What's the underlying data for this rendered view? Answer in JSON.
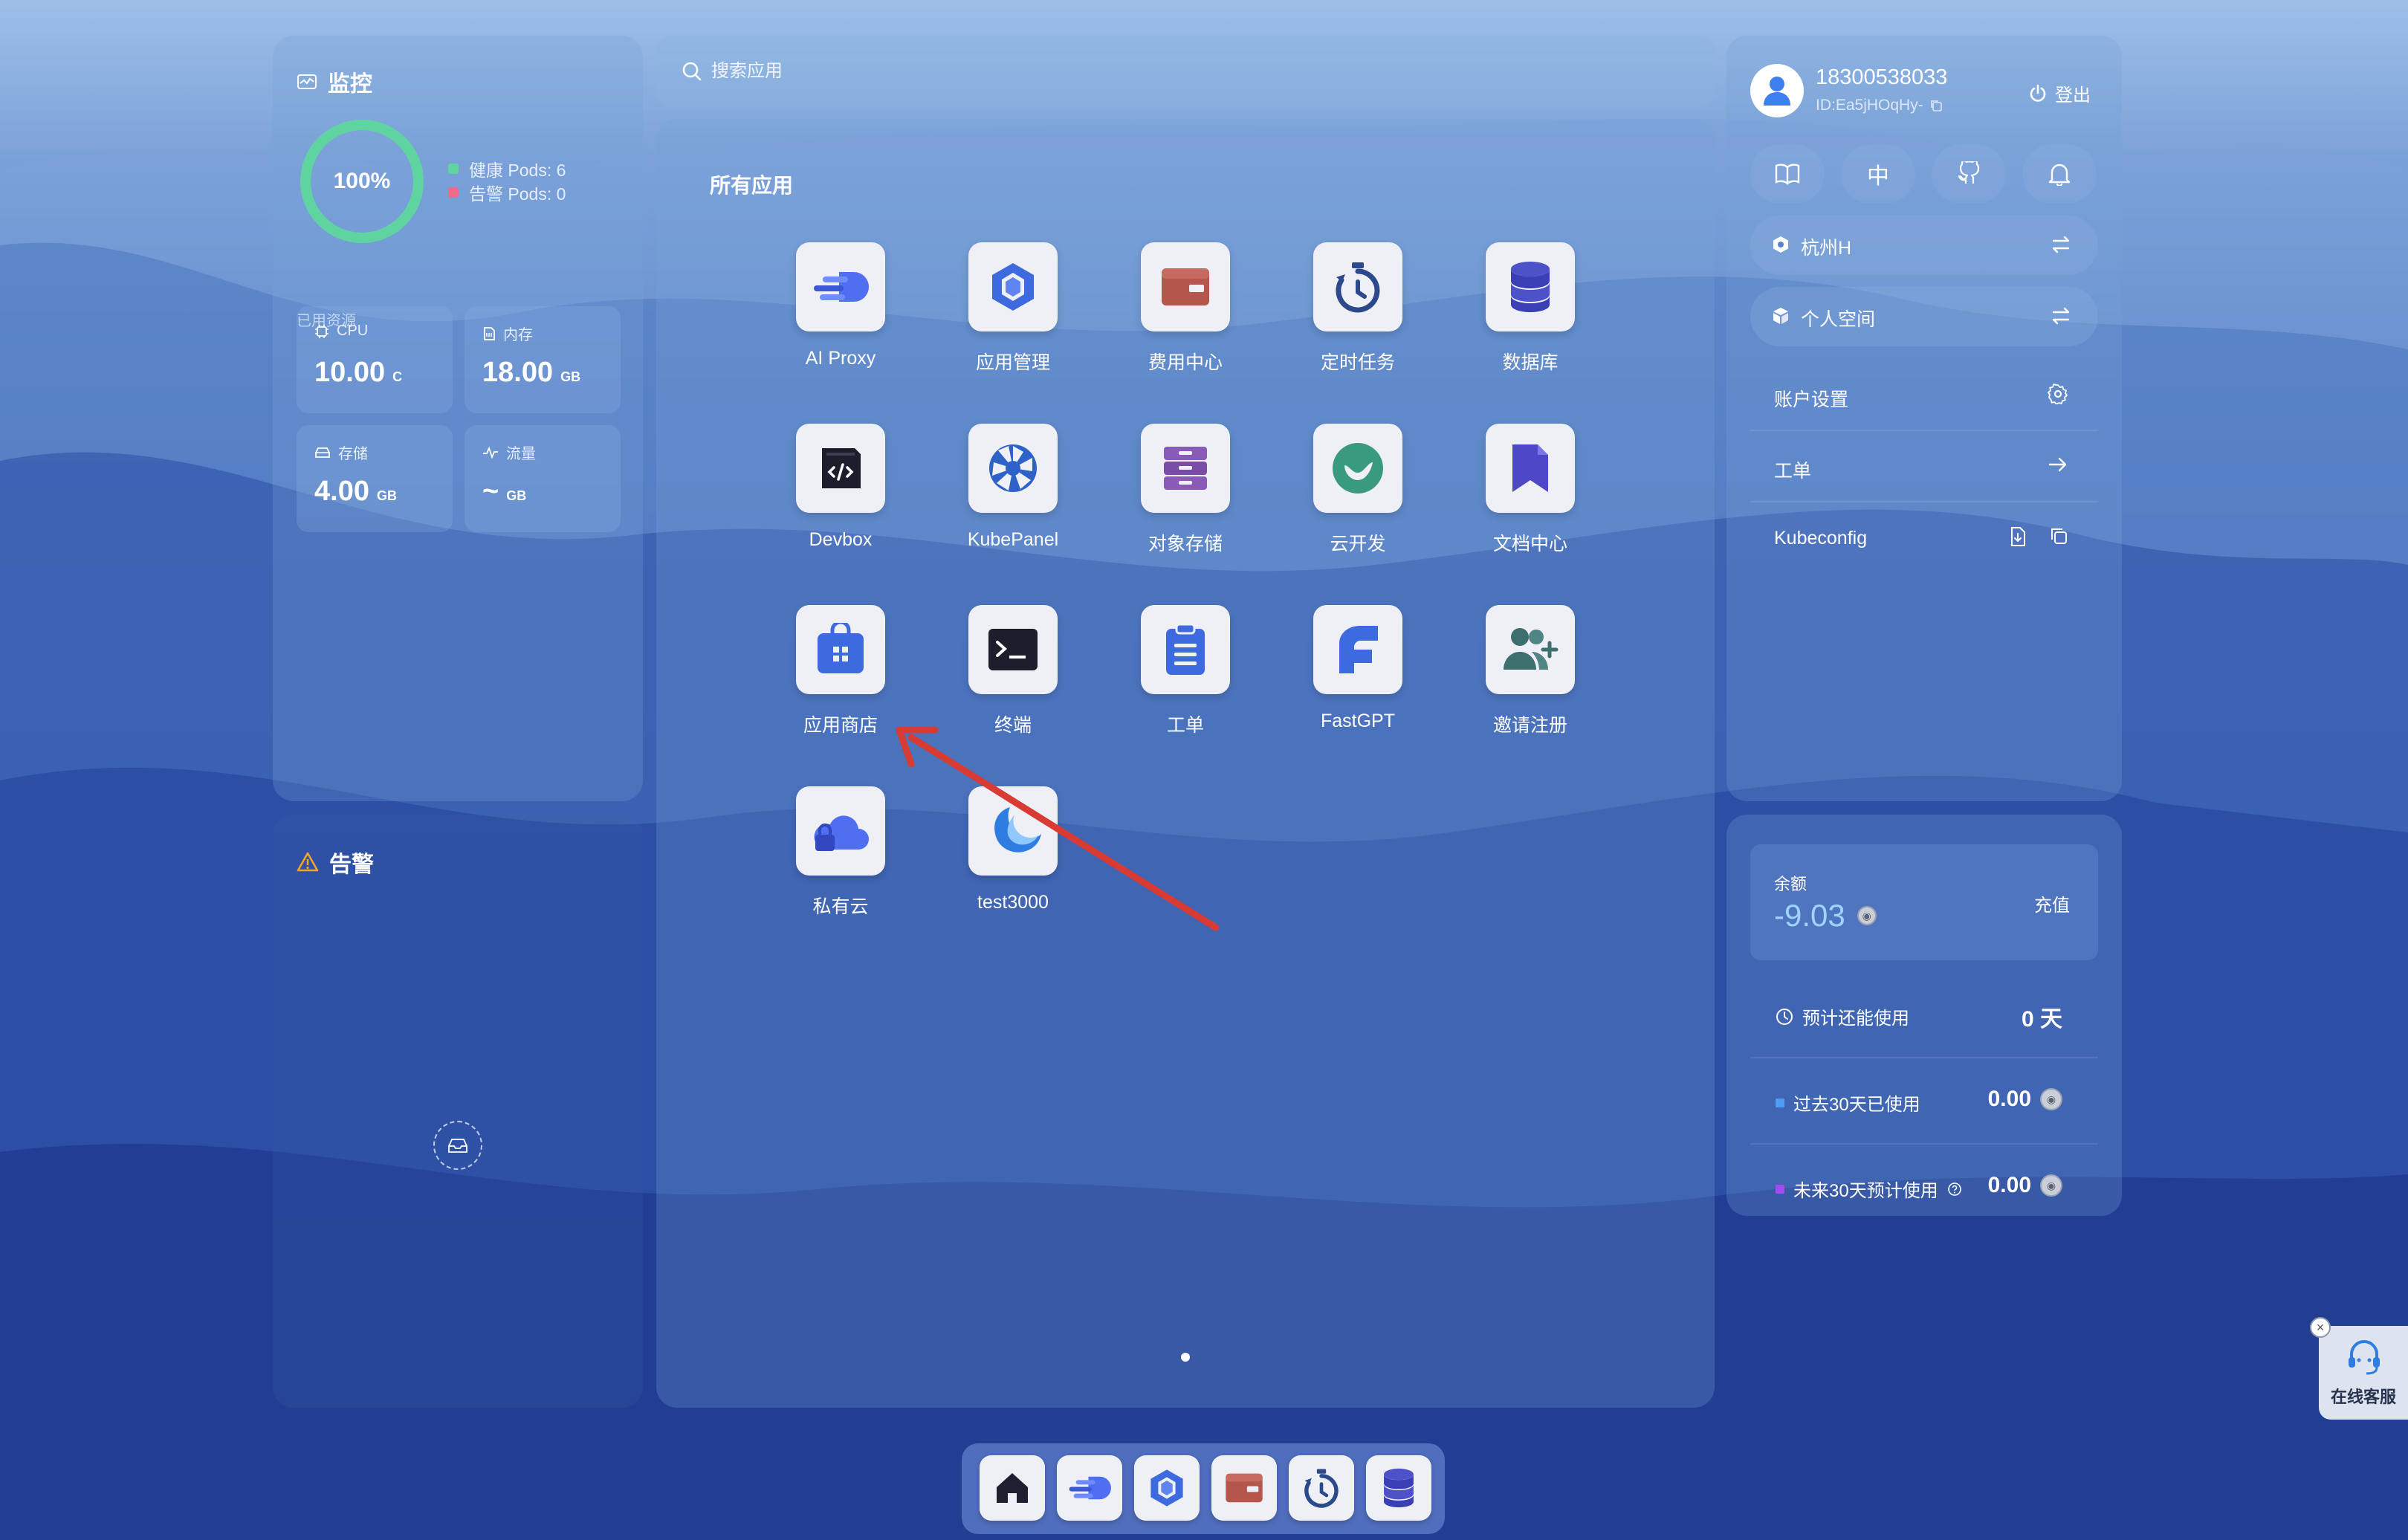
{
  "monitor": {
    "title": "监控",
    "health_percent": "100%",
    "health_fraction": 1.0,
    "healthy_pods": "健康 Pods: 6",
    "alert_pods": "告警 Pods: 0",
    "used_resources_title": "已用资源",
    "resources": [
      {
        "label": "CPU",
        "value": "10.00",
        "unit": "C",
        "icon": "cpu-icon"
      },
      {
        "label": "内存",
        "value": "18.00",
        "unit": "GB",
        "icon": "memory-icon"
      },
      {
        "label": "存储",
        "value": "4.00",
        "unit": "GB",
        "icon": "storage-icon"
      },
      {
        "label": "流量",
        "value": "~",
        "unit": "GB",
        "icon": "traffic-icon"
      }
    ]
  },
  "alerts": {
    "title": "告警"
  },
  "search": {
    "placeholder": "搜索应用"
  },
  "apps": {
    "title": "所有应用",
    "items": [
      {
        "label": "AI Proxy",
        "icon": "ai-proxy-icon"
      },
      {
        "label": "应用管理",
        "icon": "app-manage-icon"
      },
      {
        "label": "费用中心",
        "icon": "wallet-icon"
      },
      {
        "label": "定时任务",
        "icon": "timer-icon"
      },
      {
        "label": "数据库",
        "icon": "database-icon"
      },
      {
        "label": "Devbox",
        "icon": "devbox-icon"
      },
      {
        "label": "KubePanel",
        "icon": "kubepanel-icon"
      },
      {
        "label": "对象存储",
        "icon": "object-storage-icon"
      },
      {
        "label": "云开发",
        "icon": "cloud-dev-icon"
      },
      {
        "label": "文档中心",
        "icon": "docs-icon"
      },
      {
        "label": "应用商店",
        "icon": "app-store-icon"
      },
      {
        "label": "终端",
        "icon": "terminal-icon"
      },
      {
        "label": "工单",
        "icon": "ticket-icon"
      },
      {
        "label": "FastGPT",
        "icon": "fastgpt-icon"
      },
      {
        "label": "邀请注册",
        "icon": "invite-icon"
      },
      {
        "label": "私有云",
        "icon": "private-cloud-icon"
      },
      {
        "label": "test3000",
        "icon": "test3000-icon"
      }
    ]
  },
  "user": {
    "phone": "18300538033",
    "id": "ID:Ea5jHOqHy-",
    "logout": "登出",
    "lang_button": "中",
    "region": "杭州H",
    "workspace": "个人空间",
    "account_settings": "账户设置",
    "ticket": "工单",
    "kubeconfig": "Kubeconfig"
  },
  "balance": {
    "label": "余额",
    "value": "-9.03",
    "recharge": "充值",
    "remaining_label": "预计还能使用",
    "remaining_value": "0 天",
    "past_label": "过去30天已使用",
    "past_value": "0.00",
    "future_label": "未来30天预计使用",
    "future_value": "0.00"
  },
  "dock": {
    "items": [
      "home-icon",
      "ai-proxy-icon",
      "app-manage-icon",
      "wallet-icon",
      "timer-icon",
      "database-icon"
    ]
  },
  "support": {
    "label": "在线客服"
  },
  "colors": {
    "healthy": "#5fd3a0",
    "alert": "#f06a8a",
    "balance": "#9fd3ff",
    "past_dot": "#4e9cf5",
    "future_dot": "#a04cf0"
  }
}
